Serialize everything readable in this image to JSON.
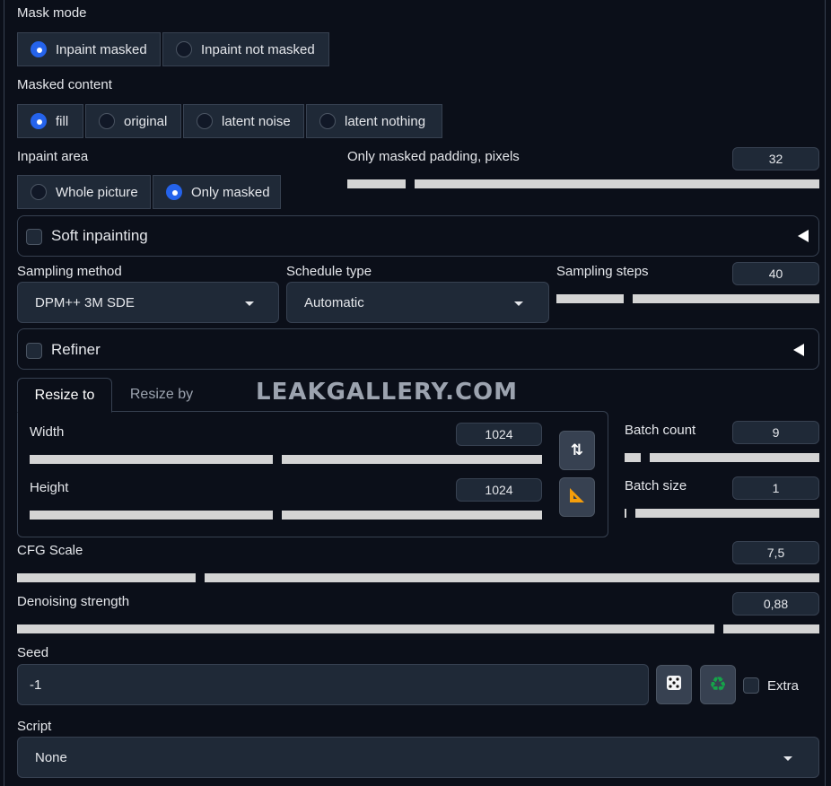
{
  "mask_mode": {
    "label": "Mask mode",
    "options": [
      "Inpaint masked",
      "Inpaint not masked"
    ],
    "selected": "Inpaint masked"
  },
  "masked_content": {
    "label": "Masked content",
    "options": [
      "fill",
      "original",
      "latent noise",
      "latent nothing"
    ],
    "selected": "fill"
  },
  "inpaint_area": {
    "label": "Inpaint area",
    "options": [
      "Whole picture",
      "Only masked"
    ],
    "selected": "Only masked"
  },
  "padding": {
    "label": "Only masked padding, pixels",
    "value": "32"
  },
  "soft_inpainting": {
    "label": "Soft inpainting",
    "checked": false
  },
  "sampling_method": {
    "label": "Sampling method",
    "value": "DPM++ 3M SDE"
  },
  "schedule_type": {
    "label": "Schedule type",
    "value": "Automatic"
  },
  "sampling_steps": {
    "label": "Sampling steps",
    "value": "40"
  },
  "refiner": {
    "label": "Refiner",
    "checked": false
  },
  "tabs": [
    {
      "label": "Resize to",
      "active": true
    },
    {
      "label": "Resize by",
      "active": false
    }
  ],
  "watermark": "LEAKGALLERY.COM",
  "width": {
    "label": "Width",
    "value": "1024"
  },
  "height": {
    "label": "Height",
    "value": "1024"
  },
  "batch_count": {
    "label": "Batch count",
    "value": "9"
  },
  "batch_size": {
    "label": "Batch size",
    "value": "1"
  },
  "cfg_scale": {
    "label": "CFG Scale",
    "value": "7,5"
  },
  "denoising": {
    "label": "Denoising strength",
    "value": "0,88"
  },
  "seed": {
    "label": "Seed",
    "value": "-1",
    "extra_label": "Extra"
  },
  "script": {
    "label": "Script",
    "value": "None"
  },
  "icons": {
    "swap": "swap-dimensions-icon",
    "ratio": "triangle-ruler-icon",
    "dice": "dice-icon",
    "recycle": "recycle-icon"
  }
}
